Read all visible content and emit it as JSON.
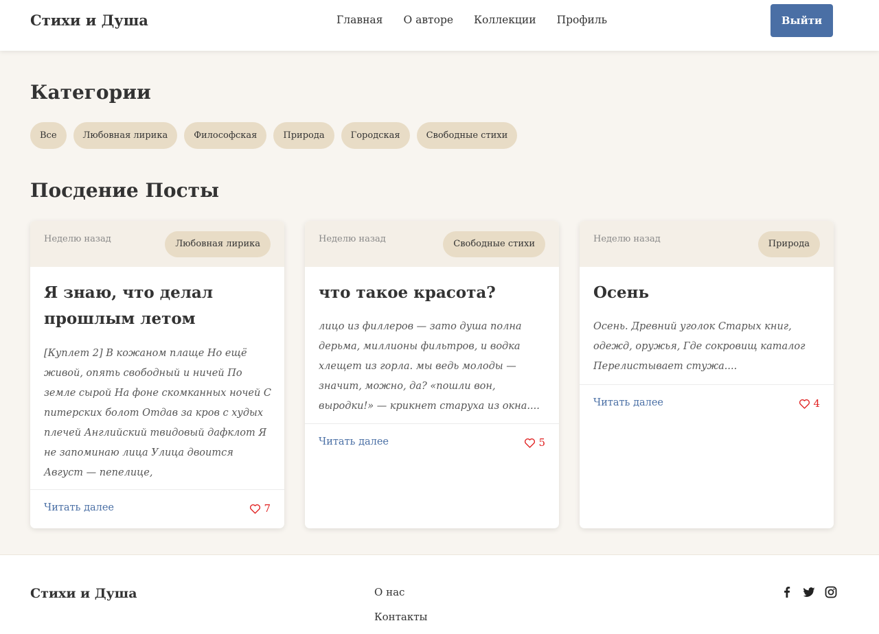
{
  "header": {
    "logo": "Стихи и Душа",
    "nav": [
      "Главная",
      "О авторе",
      "Коллекции",
      "Профиль"
    ],
    "logout_label": "Выйти"
  },
  "categories": {
    "title": "Категории",
    "items": [
      "Все",
      "Любовная лирика",
      "Философская",
      "Природа",
      "Городская",
      "Свободные стихи"
    ]
  },
  "posts": {
    "title": "Посдение Посты",
    "items": [
      {
        "date": "Неделю назад",
        "category": "Любовная лирика",
        "title": "Я знаю, что делал прошлым летом",
        "excerpt": "[Куплет 2] В кожаном плаще Но ещё живой, опять свободный и ничей По земле сырой На фоне скомканных ночей С питерских болот Отдав за кров с худых плечей Английский твидовый дафклот Я не запоминаю лица Улица двоится Август — пепелице,",
        "read_more": "Читать далее",
        "likes": "7"
      },
      {
        "date": "Неделю назад",
        "category": "Свободные стихи",
        "title": "что такое красота?",
        "excerpt": "лицо из филлеров — зато душа полна дерьма, миллионы фильтров, и водка хлещет из горла. мы ведь молоды — значит, можно, да? «пошли вон, выродки!» — крикнет старуха из окна....",
        "read_more": "Читать далее",
        "likes": "5"
      },
      {
        "date": "Неделю назад",
        "category": "Природа",
        "title": "Осень",
        "excerpt": "Осень. Древний уголок Старых книг, одежд, оружья, Где сокровищ каталог Перелистывает стужа....",
        "read_more": "Читать далее",
        "likes": "4"
      }
    ]
  },
  "footer": {
    "logo": "Стихи и Душа",
    "links": [
      "О нас",
      "Контакты"
    ],
    "social_icons": [
      "facebook-icon",
      "twitter-icon",
      "instagram-icon"
    ]
  },
  "colors": {
    "accent": "#4a6fa5",
    "background": "#f8f5f0",
    "tag": "#e8dcc6",
    "like": "#e02020"
  }
}
